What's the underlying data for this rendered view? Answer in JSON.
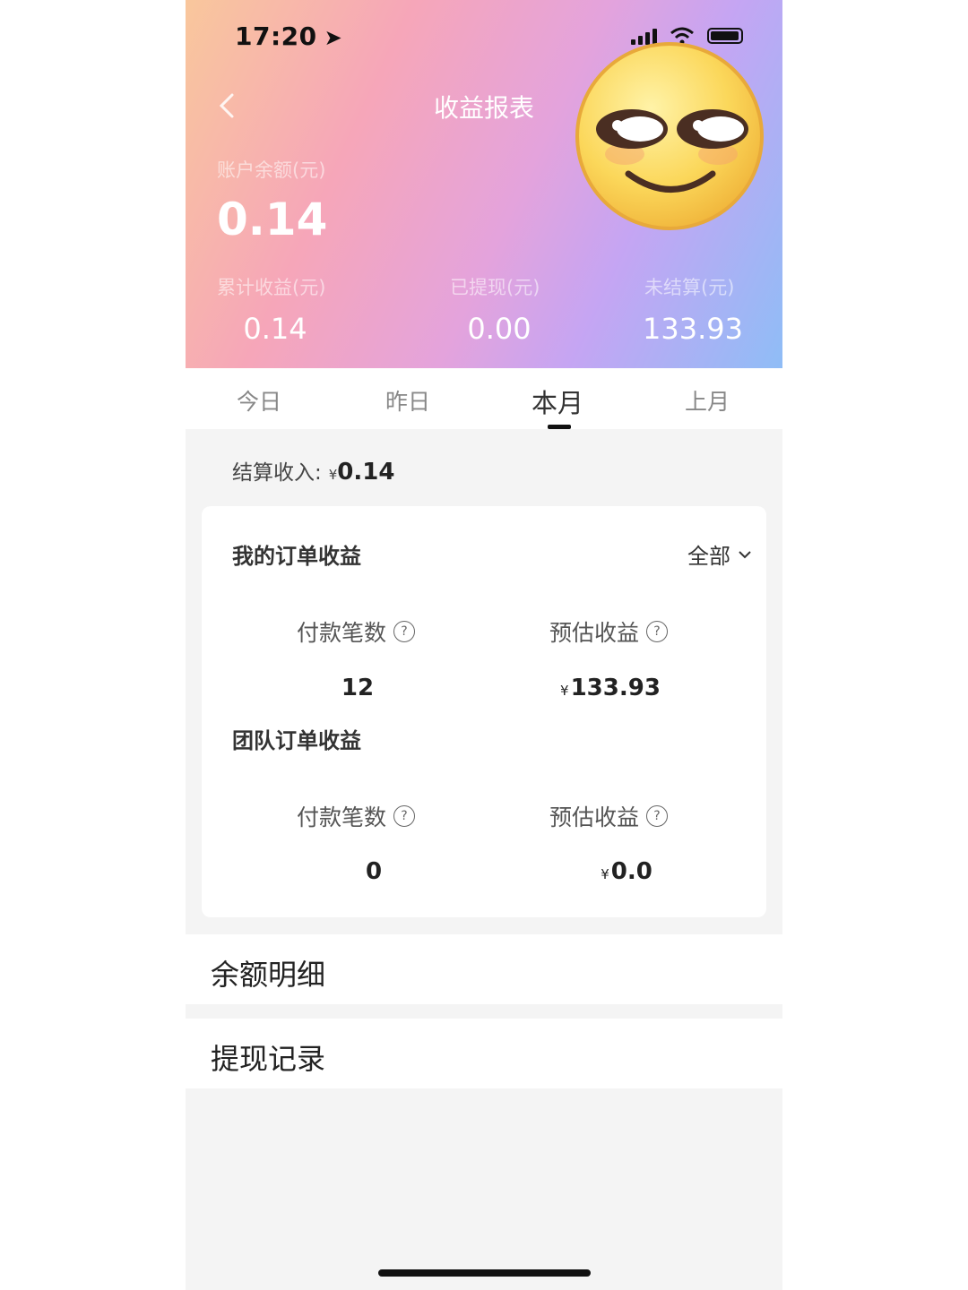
{
  "status_bar": {
    "time": "17:20",
    "location_icon": "location-arrow-icon"
  },
  "header": {
    "title": "收益报表",
    "back_icon": "chevron-left-icon"
  },
  "balance": {
    "label": "账户余额(元)",
    "value": "0.14"
  },
  "stats": [
    {
      "label": "累计收益(元)",
      "value": "0.14"
    },
    {
      "label": "已提现(元)",
      "value": "0.00"
    },
    {
      "label": "未结算(元)",
      "value": "133.93"
    }
  ],
  "tabs": [
    {
      "label": "今日"
    },
    {
      "label": "昨日"
    },
    {
      "label": "本月",
      "active": true
    },
    {
      "label": "上月"
    }
  ],
  "settlement": {
    "label": "结算收入:",
    "currency": "¥",
    "value": "0.14"
  },
  "my_orders": {
    "title": "我的订单收益",
    "filter": "全部",
    "count_label": "付款笔数",
    "count_value": "12",
    "income_label": "预估收益",
    "currency": "¥",
    "income_value": "133.93"
  },
  "team_orders": {
    "title": "团队订单收益",
    "count_label": "付款笔数",
    "count_value": "0",
    "income_label": "预估收益",
    "currency": "¥",
    "income_value": "0.0"
  },
  "help_icon_glyph": "?",
  "links": {
    "balance_detail": "余额明细",
    "withdraw_record": "提现记录"
  },
  "colors": {
    "gradient_start": "#f9c79c",
    "gradient_mid": "#e4a3dc",
    "gradient_end": "#8fbdf6",
    "emoji_yellow": "#fbd75a"
  }
}
